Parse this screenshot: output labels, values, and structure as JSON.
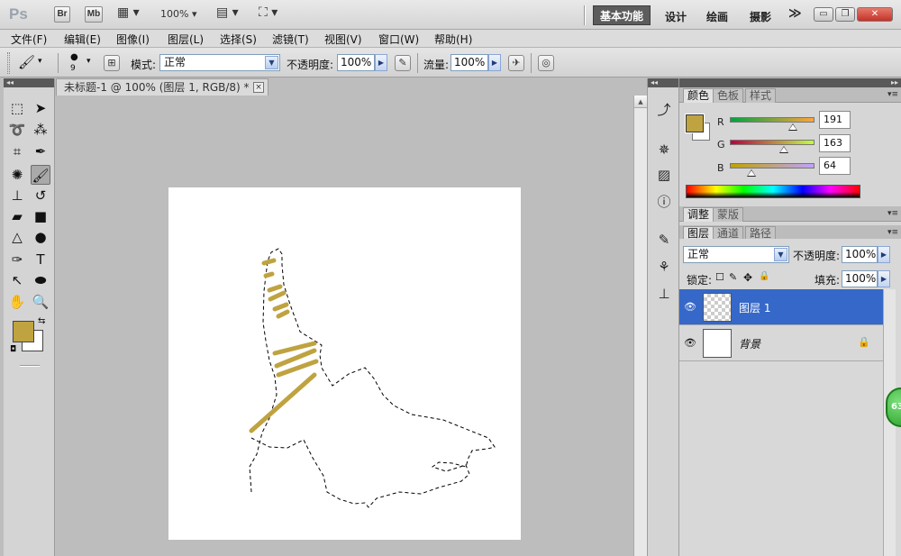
{
  "app": {
    "logo": "Ps",
    "bridge_label": "Br",
    "minibridge_label": "Mb",
    "zoom": "100%",
    "workspaces": {
      "active": "基本功能",
      "items": [
        "设计",
        "绘画",
        "摄影"
      ],
      "more": "≫"
    }
  },
  "menu": {
    "items": [
      "文件(F)",
      "编辑(E)",
      "图像(I)",
      "图层(L)",
      "选择(S)",
      "滤镜(T)",
      "视图(V)",
      "窗口(W)",
      "帮助(H)"
    ]
  },
  "options": {
    "brush_size": "9",
    "mode_label": "模式:",
    "mode_value": "正常",
    "opacity_label": "不透明度:",
    "opacity_value": "100%",
    "flow_label": "流量:",
    "flow_value": "100%"
  },
  "document": {
    "tab_title": "未标题-1 @ 100% (图层 1, RGB/8) *",
    "close": "×"
  },
  "color_panel": {
    "tabs": [
      "颜色",
      "色板",
      "样式"
    ],
    "r_label": "R",
    "r_value": "191",
    "g_label": "G",
    "g_value": "163",
    "b_label": "B",
    "b_value": "64",
    "foreground": "#BFA340",
    "background": "#FFFFFF",
    "r_fraction": 0.749,
    "g_fraction": 0.639,
    "b_fraction": 0.251
  },
  "adjust_panel": {
    "tabs": [
      "调整",
      "蒙版"
    ]
  },
  "layers_panel": {
    "tabs": [
      "图层",
      "通道",
      "路径"
    ],
    "blend_mode": "正常",
    "opacity_label": "不透明度:",
    "opacity_value": "100%",
    "lock_label": "锁定:",
    "fill_label": "填充:",
    "fill_value": "100%",
    "layers": [
      {
        "name": "图层 1",
        "selected": true
      },
      {
        "name": "背景",
        "selected": false,
        "locked": true
      }
    ]
  },
  "notification_badge": "63",
  "colors": {
    "brush": "#BFA340",
    "selected_layer": "#3568C8",
    "active_workspace": "#5C5C5C"
  }
}
